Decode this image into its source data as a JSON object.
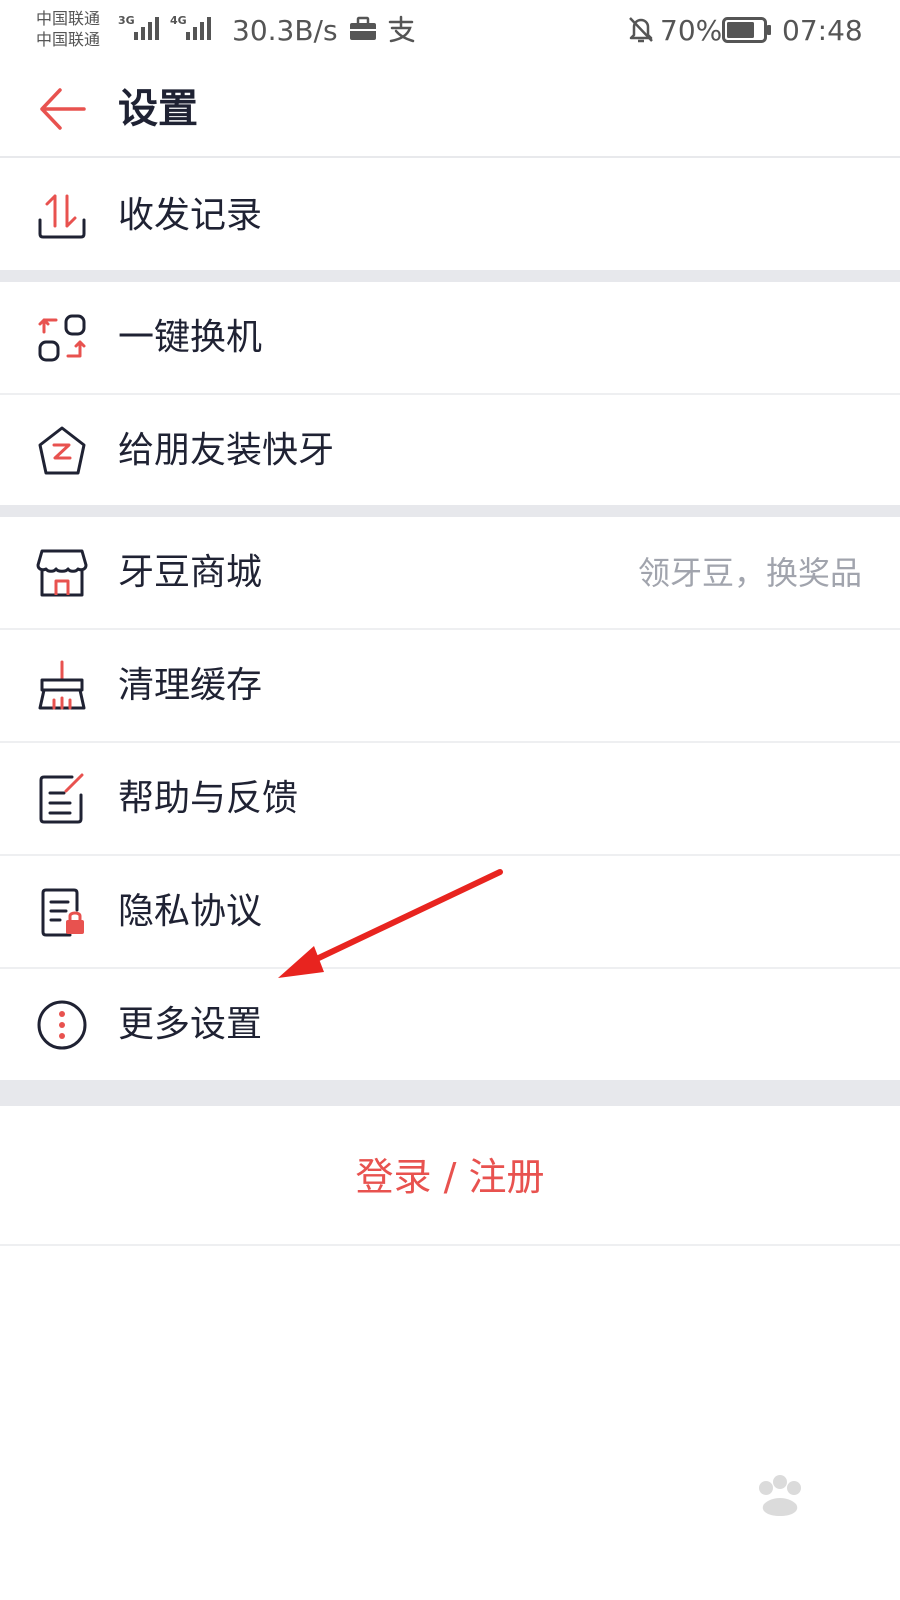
{
  "status_bar": {
    "carrier_1": "中国联通",
    "carrier_2": "中国联通",
    "net_1": "3G",
    "net_2": "4G",
    "speed": "30.3B/s",
    "battery": "70%",
    "time": "07:48"
  },
  "header": {
    "title": "设置"
  },
  "menu": {
    "items": [
      {
        "label": "收发记录",
        "icon": "transfer-record-icon"
      },
      {
        "label": "一键换机",
        "icon": "phone-switch-icon"
      },
      {
        "label": "给朋友装快牙",
        "icon": "share-app-icon"
      },
      {
        "label": "牙豆商城",
        "icon": "store-icon",
        "hint": "领牙豆，换奖品"
      },
      {
        "label": "清理缓存",
        "icon": "broom-icon"
      },
      {
        "label": "帮助与反馈",
        "icon": "feedback-icon"
      },
      {
        "label": "隐私协议",
        "icon": "privacy-icon"
      },
      {
        "label": "更多设置",
        "icon": "more-icon"
      }
    ]
  },
  "login": {
    "label": "登录 / 注册"
  },
  "colors": {
    "accent": "#e8524f",
    "text": "#1f2233",
    "hint": "#a1a4ad",
    "band": "#e7e8ec"
  }
}
